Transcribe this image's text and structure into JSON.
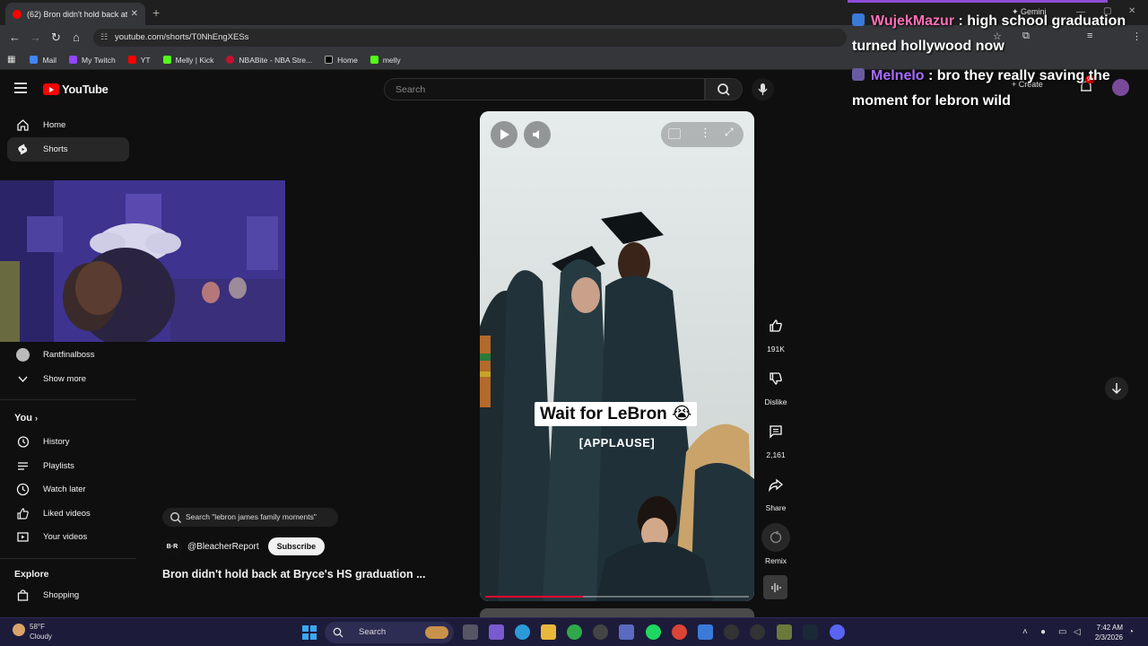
{
  "browser": {
    "tab_title": "(62) Bron didn't hold back at B",
    "url": "youtube.com/shorts/T0NhEngXESs",
    "bookmarks": [
      "Mail",
      "My Twitch",
      "YT",
      "Melly | Kick",
      "NBABite - NBA Stre...",
      "Home",
      "melly"
    ]
  },
  "youtube": {
    "logo": "YouTube",
    "search_placeholder": "Search",
    "create_label": "Create",
    "notification_count": "9+"
  },
  "sidebar": {
    "home": "Home",
    "shorts": "Shorts",
    "subscription_channel": "Rantfinalboss",
    "show_more": "Show more",
    "you_heading": "You",
    "you_items": [
      "History",
      "Playlists",
      "Watch later",
      "Liked videos",
      "Your videos"
    ],
    "explore_heading": "Explore",
    "explore_items": [
      "Shopping"
    ]
  },
  "short": {
    "caption_main": "Wait for LeBron 😭",
    "caption_sub": "[APPLAUSE]",
    "progress": 0.37,
    "likes": "191K",
    "dislike_label": "Dislike",
    "comments": "2,161",
    "share_label": "Share",
    "remix_label": "Remix",
    "related_search": "Search \"lebron james family moments\"",
    "channel_logo": "B·R",
    "channel": "@BleacherReport",
    "subscribe_label": "Subscribe",
    "title": "Bron didn't hold back at Bryce's HS graduation ..."
  },
  "chat": [
    {
      "user": "WujekMazur",
      "message": "high school graduation turned hollywood now"
    },
    {
      "user": "Melnelo",
      "message": "bro they really saving the moment for lebron wild"
    }
  ],
  "gemini_label": "Gemini",
  "taskbar": {
    "temperature": "58°F",
    "condition": "Cloudy",
    "search_label": "Search",
    "time": "7:42 AM",
    "date": "2/3/2026"
  },
  "colors": {
    "youtube_red": "#ff0000",
    "chat_user1": "#ff6fb5",
    "chat_user2": "#a96cff",
    "progress_red": "#ff0033"
  }
}
